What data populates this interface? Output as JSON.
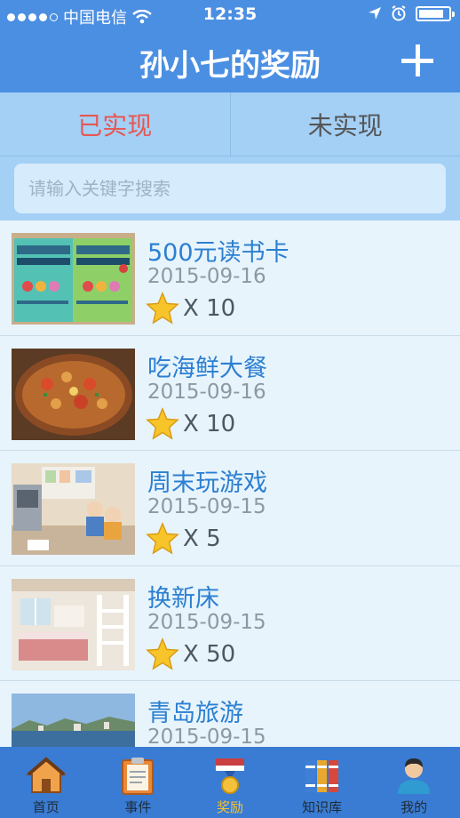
{
  "status_bar": {
    "carrier": "中国电信",
    "time": "12:35",
    "battery_level": 0.85
  },
  "nav": {
    "title": "孙小七的奖励",
    "add_icon": "plus-icon"
  },
  "tabs": [
    {
      "label": "已实现",
      "active": true
    },
    {
      "label": "未实现",
      "active": false
    }
  ],
  "search": {
    "placeholder": "请输入关键字搜索",
    "value": ""
  },
  "rewards": [
    {
      "title": "500元读书卡",
      "date": "2015-09-16",
      "points": "X 10"
    },
    {
      "title": "吃海鲜大餐",
      "date": "2015-09-16",
      "points": "X 10"
    },
    {
      "title": "周末玩游戏",
      "date": "2015-09-15",
      "points": "X 5"
    },
    {
      "title": "换新床",
      "date": "2015-09-15",
      "points": "X 50"
    },
    {
      "title": "青岛旅游",
      "date": "2015-09-15",
      "points": ""
    }
  ],
  "tab_bar": [
    {
      "label": "首页",
      "icon": "house-icon"
    },
    {
      "label": "事件",
      "icon": "clipboard-icon"
    },
    {
      "label": "奖励",
      "icon": "medal-icon",
      "active": true
    },
    {
      "label": "知识库",
      "icon": "books-icon"
    },
    {
      "label": "我的",
      "icon": "person-icon"
    }
  ],
  "colors": {
    "primary": "#4b8fe2",
    "active_tab": "#e65752",
    "title_text": "#2c7fd1",
    "tab_bar_active": "#f4c13a"
  }
}
